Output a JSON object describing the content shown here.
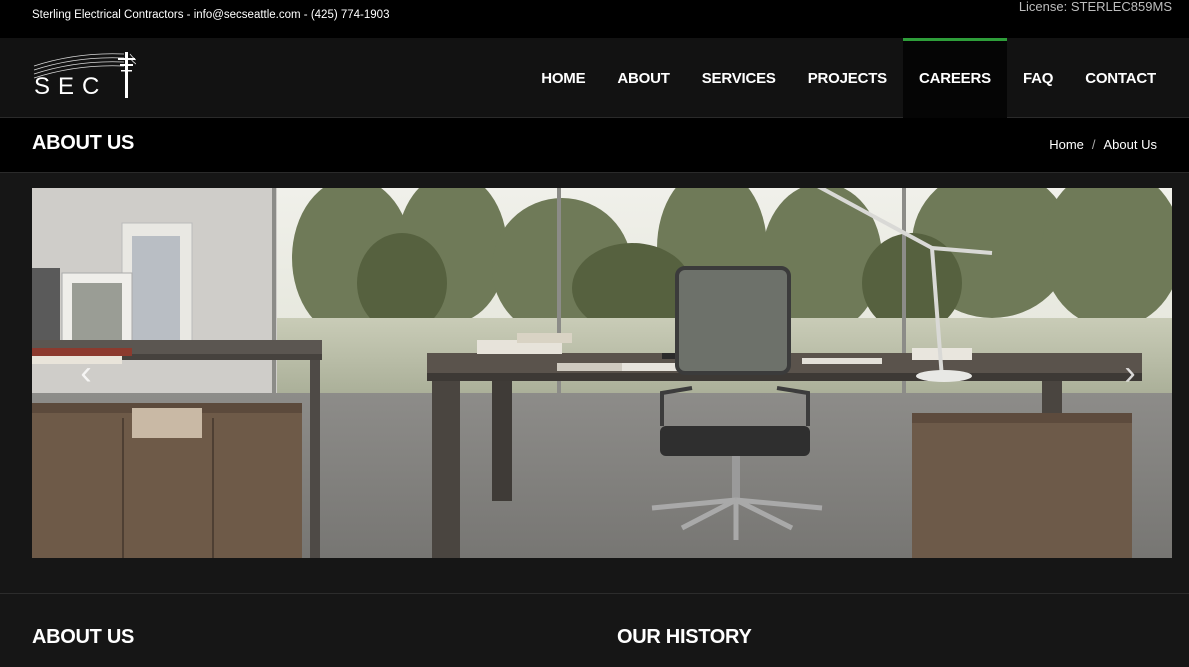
{
  "topbar": {
    "contact": "Sterling Electrical Contractors - info@secseattle.com - (425) 774-1903",
    "license": "License: STERLEC859MS"
  },
  "logo": {
    "text": "SEC",
    "icon": "power-pole-icon"
  },
  "nav": {
    "items": [
      {
        "label": "HOME"
      },
      {
        "label": "ABOUT"
      },
      {
        "label": "SERVICES"
      },
      {
        "label": "PROJECTS"
      },
      {
        "label": "CAREERS",
        "active": true
      },
      {
        "label": "FAQ"
      },
      {
        "label": "CONTACT"
      }
    ]
  },
  "page": {
    "title": "ABOUT US",
    "breadcrumb": {
      "home": "Home",
      "separator": "/",
      "current": "About Us"
    }
  },
  "slider": {
    "image": "office-desk-photo",
    "prev_icon": "chevron-left-icon",
    "next_icon": "chevron-right-icon"
  },
  "sections": {
    "left_title": "ABOUT US",
    "right_title": "OUR HISTORY"
  },
  "colors": {
    "accent": "#2e9e3a",
    "topbar_bg": "#000000",
    "header_bg": "#121212",
    "body_bg": "#161616"
  }
}
